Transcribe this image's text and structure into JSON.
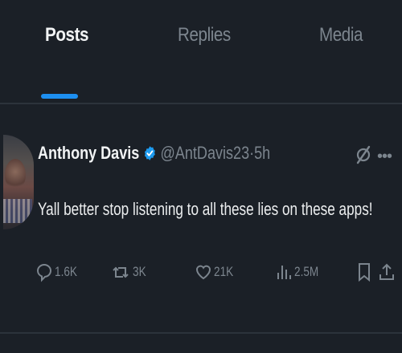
{
  "tabs": [
    {
      "label": "Posts",
      "active": true
    },
    {
      "label": "Replies",
      "active": false
    },
    {
      "label": "Media",
      "active": false
    }
  ],
  "post": {
    "author": "Anthony Davis",
    "verified": true,
    "handle": "@AntDavis23",
    "separator": "·",
    "time": "5h",
    "text": "Yall better stop listening to all these lies on these apps!",
    "icons": {
      "grok": "grok-icon",
      "more": "more-icon"
    },
    "actions": {
      "replies": "1.6K",
      "reposts": "3K",
      "likes": "21K",
      "views": "2.5M"
    }
  },
  "colors": {
    "background": "#1b2027",
    "accent": "#1d8ff0",
    "muted_text": "#7c858e",
    "primary_text": "#e7e9ea"
  }
}
